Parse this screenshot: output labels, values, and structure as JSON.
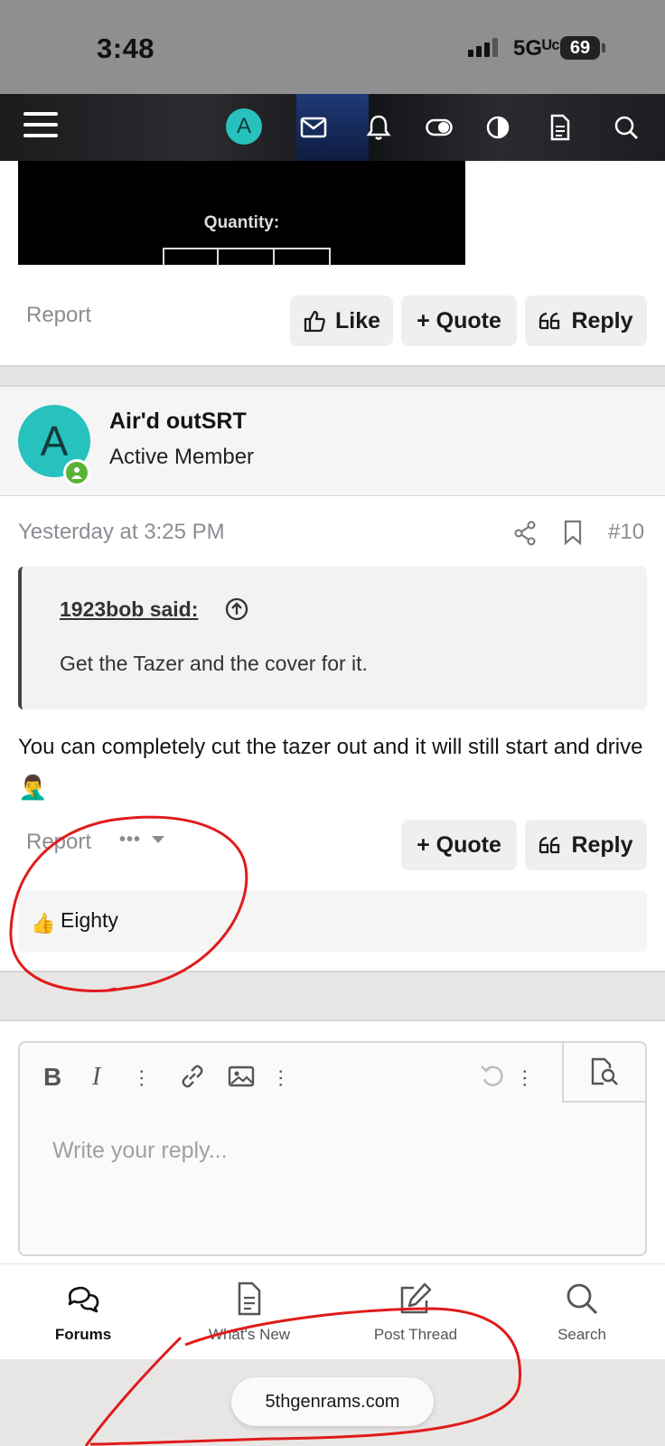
{
  "status_bar": {
    "time": "3:48",
    "network": "5Gᵁᶜ",
    "battery": "69"
  },
  "header": {
    "avatar_letter": "A"
  },
  "prev_post": {
    "image_text": "Quantity:",
    "report": "Report",
    "like": "Like",
    "quote": "+ Quote",
    "reply": "Reply"
  },
  "post": {
    "avatar_letter": "A",
    "username": "Air'd outSRT",
    "user_title": "Active Member",
    "date": "Yesterday at 3:25 PM",
    "number": "#10",
    "quote_author": "1923bob said:",
    "quote_text": "Get the Tazer and the cover for it.",
    "body": "You can completely cut the tazer out and it will still start and drive",
    "emoji": "🤦‍♂️",
    "report": "Report",
    "more": "•••",
    "quote": "+ Quote",
    "reply": "Reply",
    "reaction_emoji": "👍",
    "reaction_user": "Eighty"
  },
  "editor": {
    "placeholder": "Write your reply..."
  },
  "bottom_nav": {
    "items": [
      {
        "label": "Forums"
      },
      {
        "label": "What's New"
      },
      {
        "label": "Post Thread"
      },
      {
        "label": "Search"
      }
    ]
  },
  "browser": {
    "domain": "5thgenrams.com"
  },
  "colors": {
    "accent": "#27c1be",
    "online": "#5ab237",
    "annotation": "#e01b1b"
  }
}
